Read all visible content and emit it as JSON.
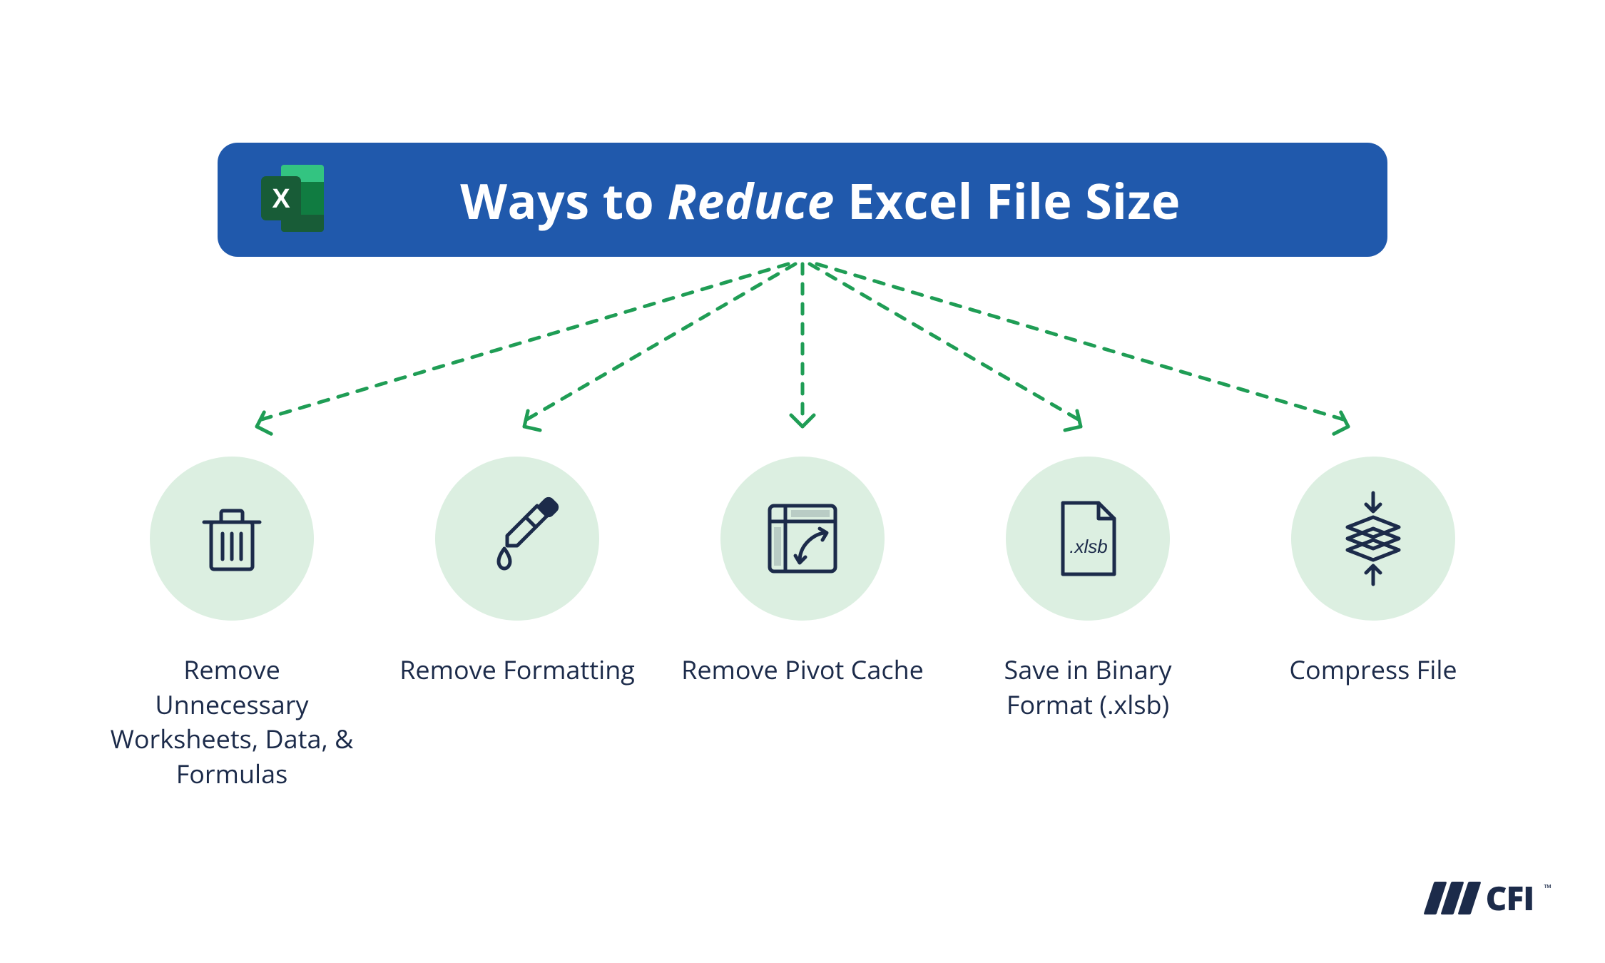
{
  "title": {
    "pre": "Ways to ",
    "em": "Reduce",
    "post": " Excel File Size"
  },
  "items": [
    {
      "icon": "trash-icon",
      "label": "Remove Unnecessary Worksheets, Data, & Formulas"
    },
    {
      "icon": "dropper-icon",
      "label": "Remove Formatting"
    },
    {
      "icon": "pivot-icon",
      "label": "Remove Pivot Cache"
    },
    {
      "icon": "xlsb-file-icon",
      "label": "Save in Binary Format (.xlsb)",
      "filetext": ".xlsb"
    },
    {
      "icon": "compress-icon",
      "label": "Compress File"
    }
  ],
  "footer": {
    "brand": "CFI"
  },
  "colors": {
    "banner": "#2059ac",
    "bubble": "#dcefe1",
    "arrow": "#1f9d55",
    "ink": "#1c2b4a",
    "excel_dark": "#185c37",
    "excel_mid": "#21a366",
    "excel_light": "#33c481"
  }
}
